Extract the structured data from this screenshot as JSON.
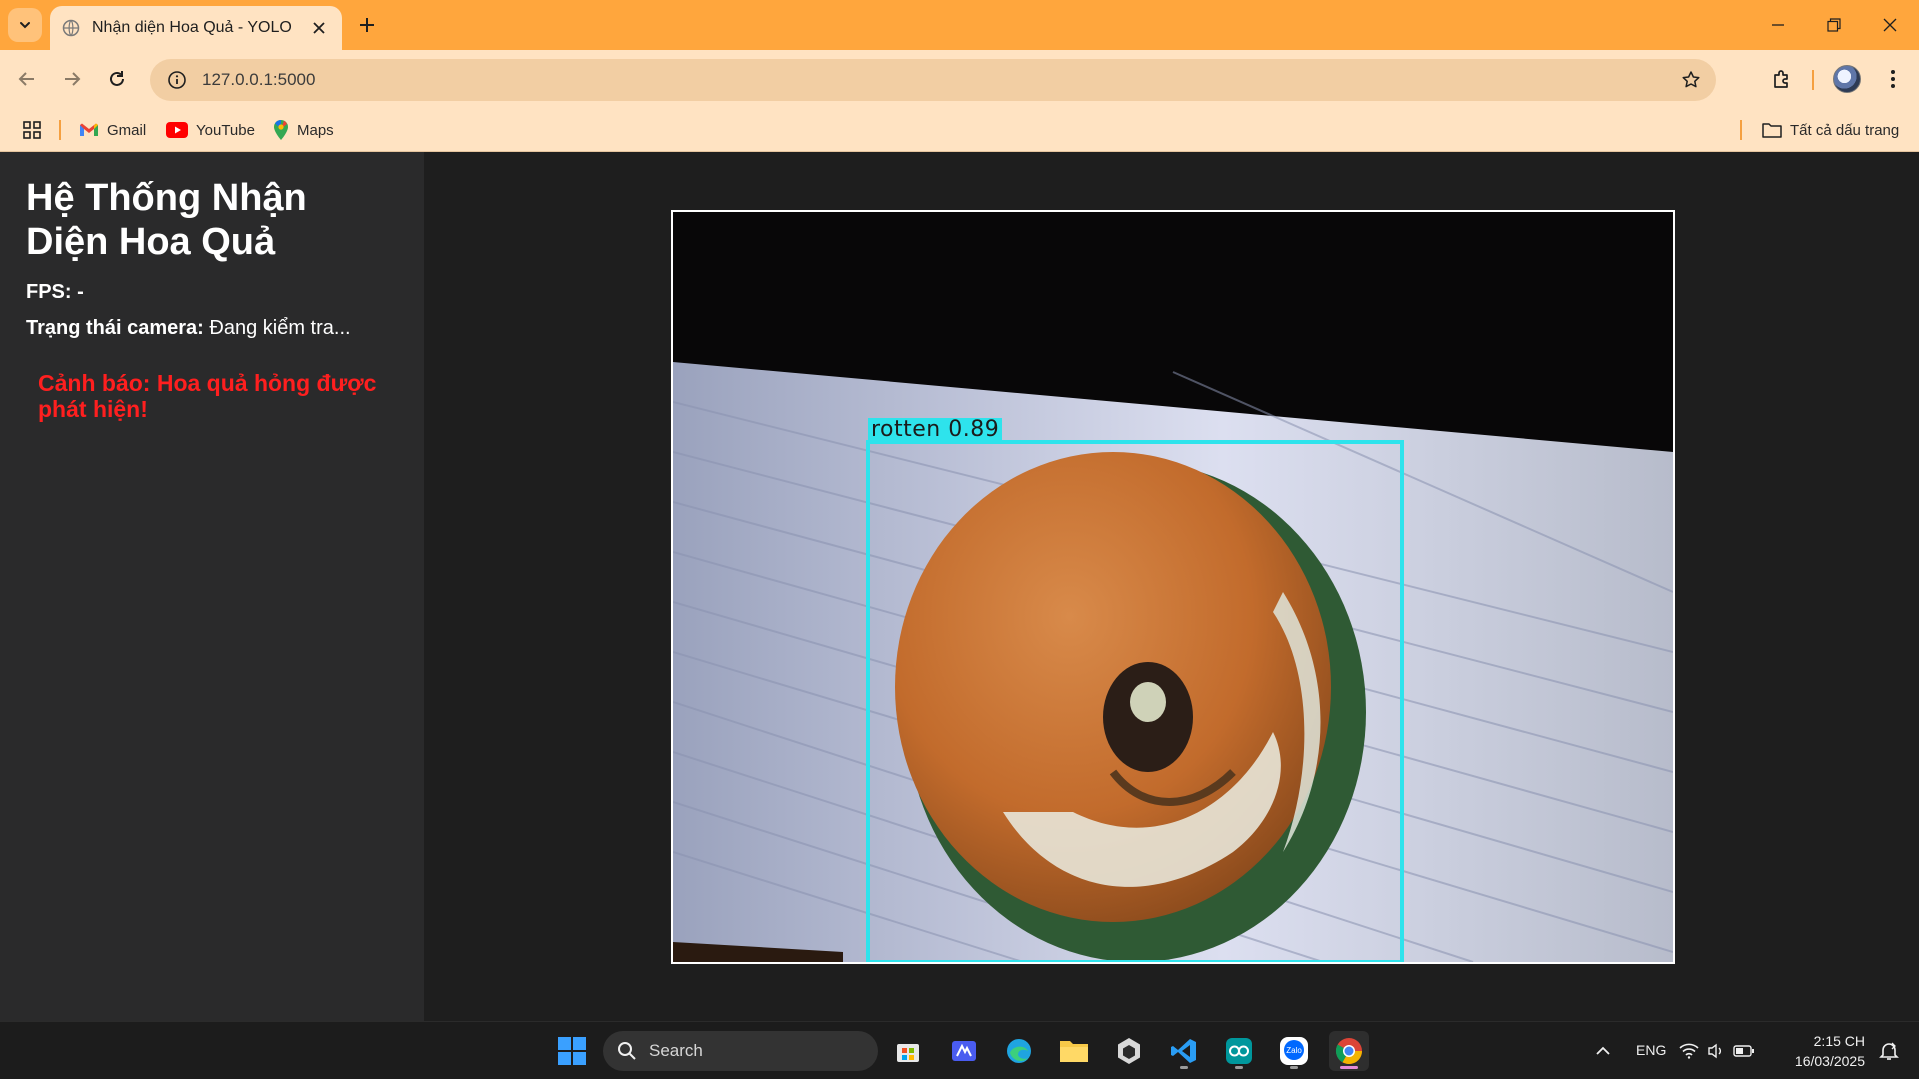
{
  "browser": {
    "tab_title": "Nhận diện Hoa Quả - YOLO",
    "url": "127.0.0.1:5000",
    "bookmarks": [
      {
        "label": "Gmail",
        "icon": "gmail-icon"
      },
      {
        "label": "YouTube",
        "icon": "youtube-icon"
      },
      {
        "label": "Maps",
        "icon": "maps-icon"
      }
    ],
    "all_bookmarks_label": "Tất cả dấu trang"
  },
  "sidebar": {
    "title": "Hệ Thống Nhận Diện Hoa Quả",
    "fps_label": "FPS:",
    "fps_value": "-",
    "camera_label": "Trạng thái camera:",
    "camera_value": "Đang kiểm tra...",
    "warning": "Cảnh báo: Hoa quả hỏng được phát hiện!"
  },
  "video": {
    "detection_label": "rotten 0.89",
    "detection_class": "rotten",
    "detection_confidence": 0.89,
    "box_color": "#2ee3ec"
  },
  "taskbar": {
    "search_placeholder": "Search",
    "language": "ENG",
    "time": "2:15 CH",
    "date": "16/03/2025"
  },
  "colors": {
    "titlebar": "#ffa63d",
    "toolbar": "#ffe3c2",
    "warning": "#ff1f1f"
  }
}
